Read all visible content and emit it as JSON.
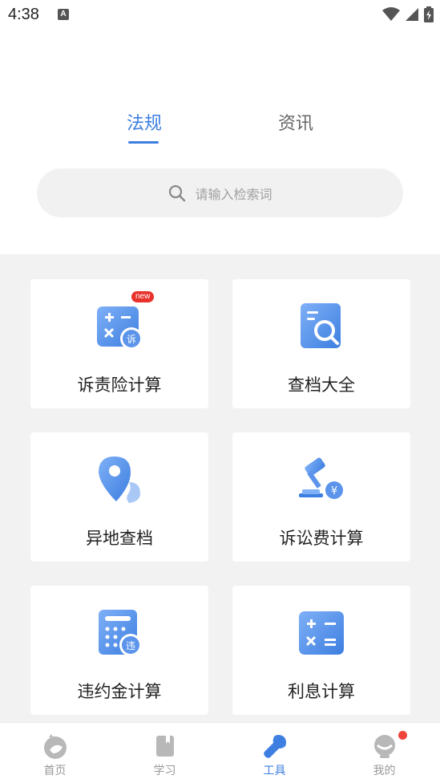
{
  "status_bar": {
    "time": "4:38",
    "notification_icon": "A"
  },
  "tabs": [
    {
      "label": "法规",
      "active": true
    },
    {
      "label": "资讯",
      "active": false
    }
  ],
  "search": {
    "placeholder": "请输入检索词"
  },
  "tools": [
    {
      "label": "诉责险计算",
      "icon": "litigation-insurance-calculator-icon",
      "badge": "new"
    },
    {
      "label": "查档大全",
      "icon": "archive-search-icon"
    },
    {
      "label": "异地查档",
      "icon": "remote-location-icon"
    },
    {
      "label": "诉讼费计算",
      "icon": "litigation-fee-gavel-icon"
    },
    {
      "label": "违约金计算",
      "icon": "penalty-calculator-icon"
    },
    {
      "label": "利息计算",
      "icon": "interest-calculator-icon"
    }
  ],
  "nav": [
    {
      "label": "首页",
      "icon": "home-icon",
      "active": false
    },
    {
      "label": "学习",
      "icon": "book-icon",
      "active": false
    },
    {
      "label": "工具",
      "icon": "wrench-icon",
      "active": true
    },
    {
      "label": "我的",
      "icon": "profile-icon",
      "active": false,
      "notification_dot": true
    }
  ],
  "colors": {
    "accent": "#3d7fe0",
    "badge_red": "#e8322c",
    "background_grey": "#f2f2f2"
  }
}
